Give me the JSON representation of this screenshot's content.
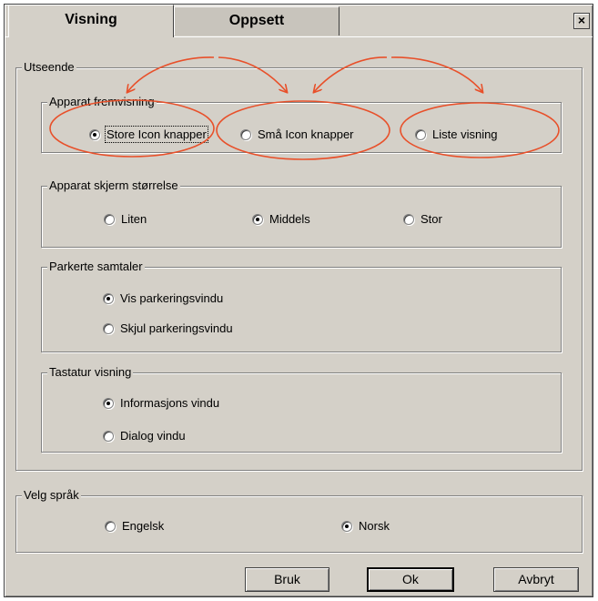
{
  "tabs": [
    {
      "label": "Visning",
      "active": true
    },
    {
      "label": "Oppsett",
      "active": false
    }
  ],
  "close_label": "×",
  "appearance": {
    "legend": "Utseende",
    "device_view": {
      "legend": "Apparat fremvisning",
      "options": [
        {
          "label": "Store Icon knapper",
          "checked": true
        },
        {
          "label": "Små Icon knapper",
          "checked": false
        },
        {
          "label": "Liste visning",
          "checked": false
        }
      ]
    },
    "screen_size": {
      "legend": "Apparat skjerm størrelse",
      "options": [
        {
          "label": "Liten",
          "checked": false
        },
        {
          "label": "Middels",
          "checked": true
        },
        {
          "label": "Stor",
          "checked": false
        }
      ]
    },
    "parked_calls": {
      "legend": "Parkerte samtaler",
      "options": [
        {
          "label": "Vis parkeringsvindu",
          "checked": true
        },
        {
          "label": "Skjul parkeringsvindu",
          "checked": false
        }
      ]
    },
    "keyboard_view": {
      "legend": "Tastatur visning",
      "options": [
        {
          "label": "Informasjons vindu",
          "checked": true
        },
        {
          "label": "Dialog vindu",
          "checked": false
        }
      ]
    }
  },
  "language": {
    "legend": "Velg språk",
    "options": [
      {
        "label": "Engelsk",
        "checked": false
      },
      {
        "label": "Norsk",
        "checked": true
      }
    ]
  },
  "buttons": {
    "apply": "Bruk",
    "ok": "Ok",
    "cancel": "Avbryt"
  },
  "colors": {
    "dialog_bg": "#d4d0c8",
    "annotation": "#e8502a"
  }
}
